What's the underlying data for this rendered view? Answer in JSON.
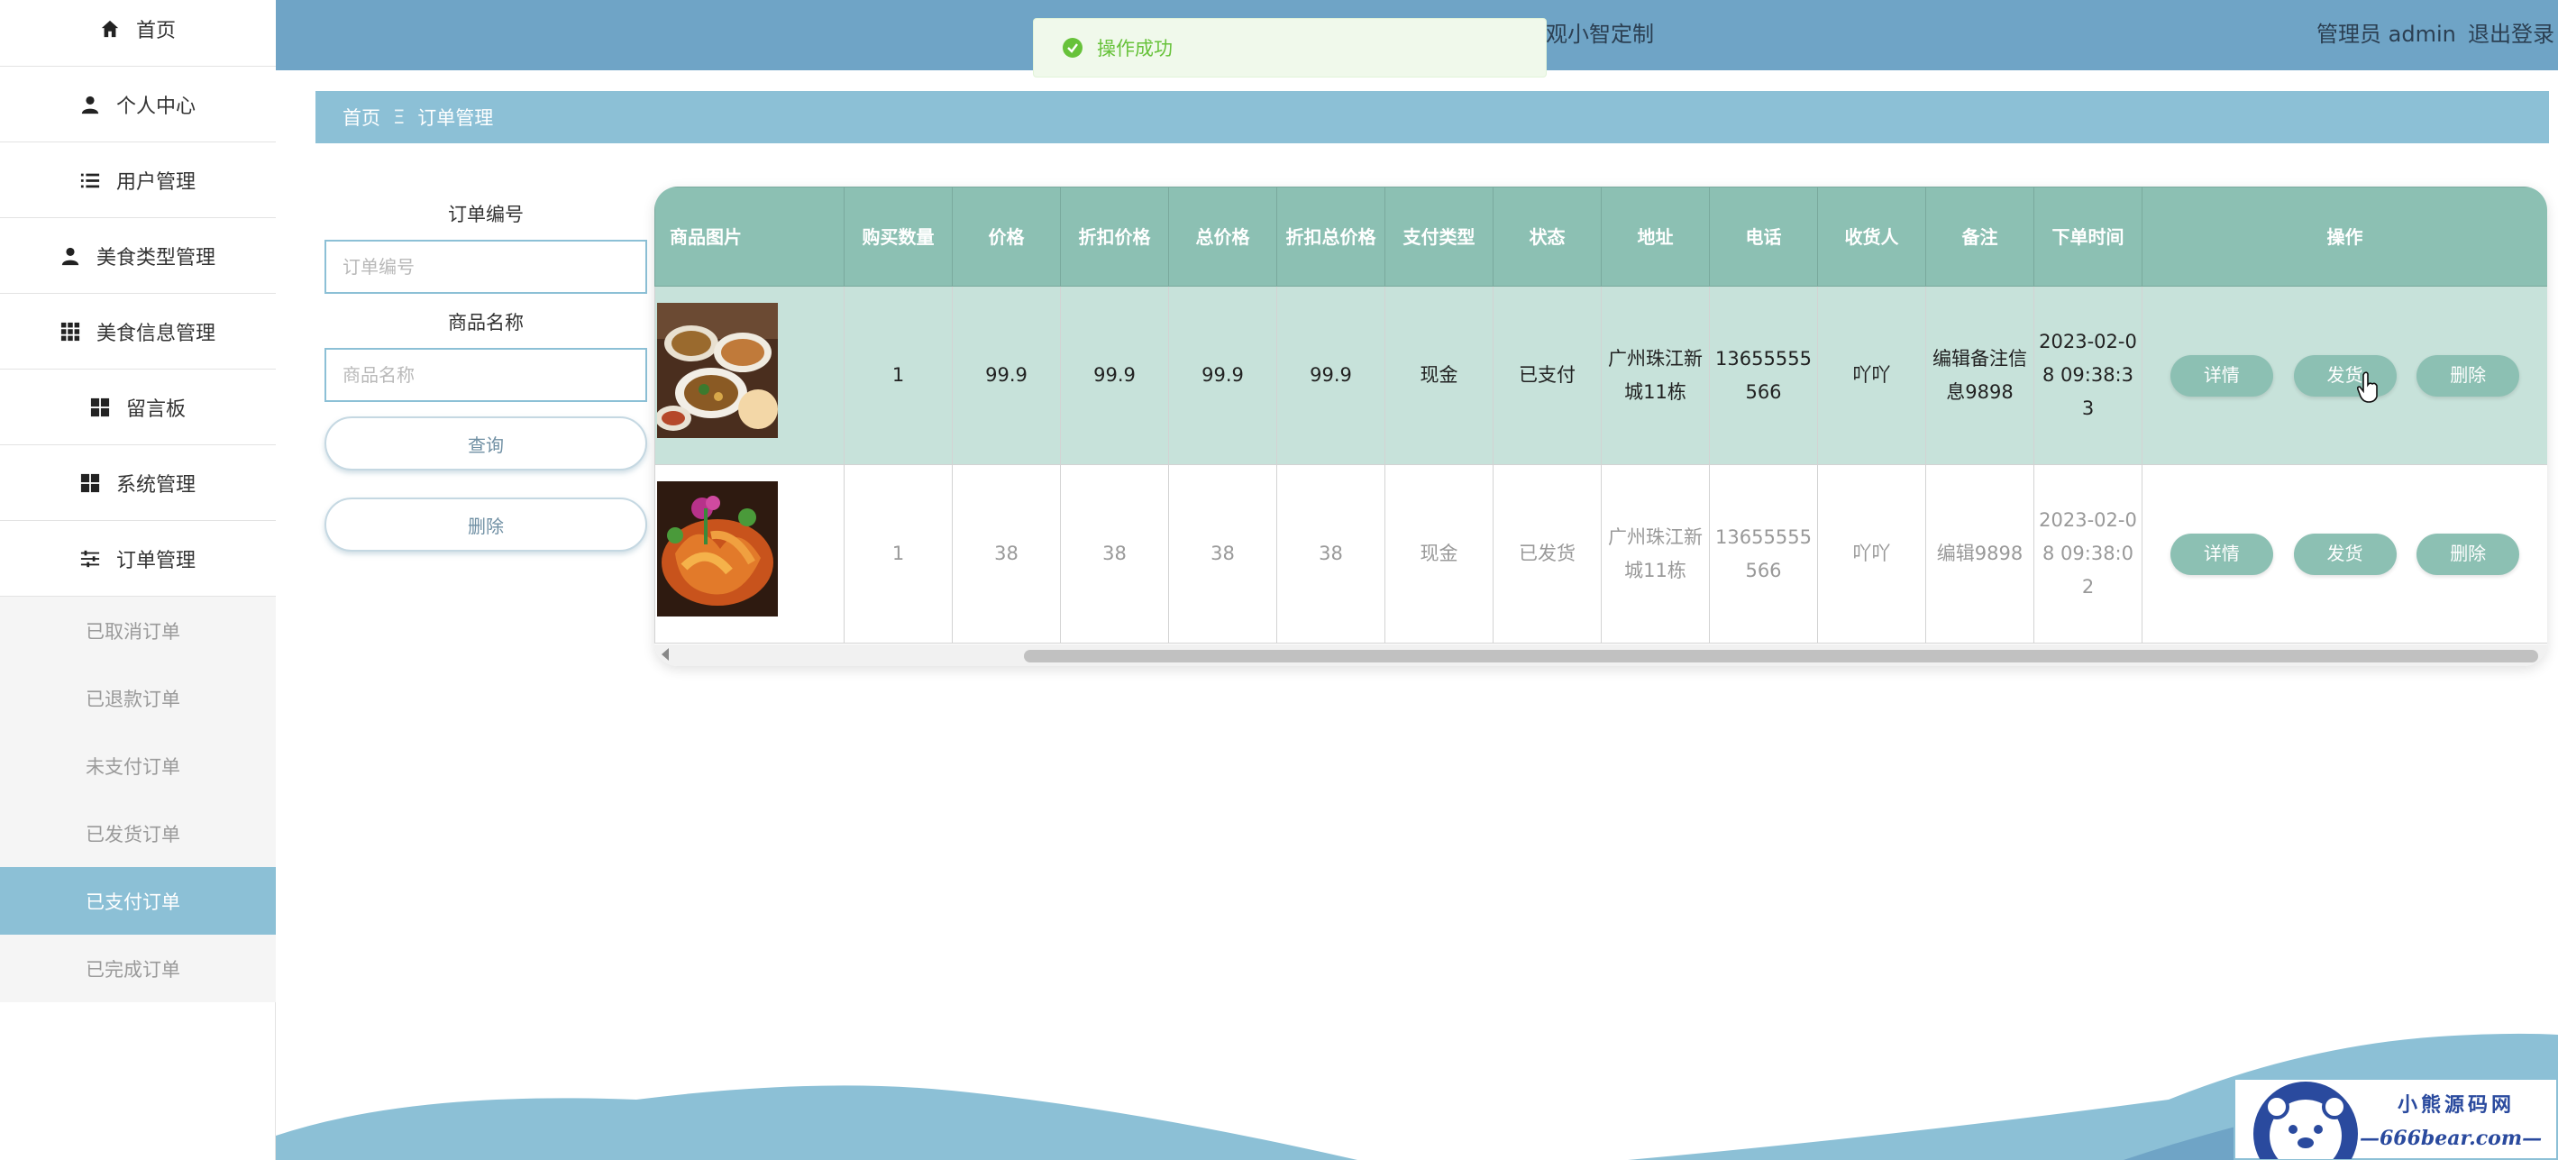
{
  "sidebar": {
    "menu": [
      {
        "label": "首页",
        "icon": "home-icon"
      },
      {
        "label": "个人中心",
        "icon": "user-icon"
      },
      {
        "label": "用户管理",
        "icon": "list-icon"
      },
      {
        "label": "美食类型管理",
        "icon": "user-icon"
      },
      {
        "label": "美食信息管理",
        "icon": "grid-icon"
      },
      {
        "label": "留言板",
        "icon": "grid-icon"
      },
      {
        "label": "系统管理",
        "icon": "grid-icon"
      },
      {
        "label": "订单管理",
        "icon": "sliders-icon"
      }
    ],
    "submenu": [
      {
        "label": "已取消订单"
      },
      {
        "label": "已退款订单"
      },
      {
        "label": "未支付订单"
      },
      {
        "label": "已发货订单"
      },
      {
        "label": "已支付订单",
        "active": true
      },
      {
        "label": "已完成订单"
      }
    ]
  },
  "header": {
    "title": "观小智定制",
    "admin": "管理员 admin",
    "logout": "退出登录"
  },
  "toast": {
    "message": "操作成功",
    "icon": "check-circle-icon",
    "color": "#67c23a"
  },
  "breadcrumb": {
    "home": "首页",
    "separator": "Ξ",
    "current": "订单管理"
  },
  "search": {
    "order_no_label": "订单编号",
    "order_no_placeholder": "订单编号",
    "order_no_value": "",
    "product_label": "商品名称",
    "product_placeholder": "商品名称",
    "product_value": "",
    "query_label": "查询",
    "delete_label": "删除"
  },
  "table": {
    "headers": [
      "商品图片",
      "购买数量",
      "价格",
      "折扣价格",
      "总价格",
      "折扣总价格",
      "支付类型",
      "状态",
      "地址",
      "电话",
      "收货人",
      "备注",
      "下单时间",
      "操作"
    ],
    "rows": [
      {
        "image": "food-plates-image",
        "qty": "1",
        "price": "99.9",
        "discount_price": "99.9",
        "total": "99.9",
        "discount_total": "99.9",
        "pay_type": "现金",
        "status": "已支付",
        "address": "广州珠江新城11栋",
        "phone": "13655555566",
        "receiver": "吖吖",
        "note": "编辑备注信息9898",
        "time": "2023-02-08 09:38:33",
        "actions": {
          "detail": "详情",
          "ship": "发货",
          "delete": "删除"
        }
      },
      {
        "image": "fried-shrimp-image",
        "qty": "1",
        "price": "38",
        "discount_price": "38",
        "total": "38",
        "discount_total": "38",
        "pay_type": "现金",
        "status": "已发货",
        "address": "广州珠江新城11栋",
        "phone": "13655555566",
        "receiver": "吖吖",
        "note": "编辑9898",
        "time": "2023-02-08 09:38:02",
        "actions": {
          "detail": "详情",
          "ship": "发货",
          "delete": "删除"
        }
      }
    ]
  },
  "watermark": {
    "line1": "小熊源码网",
    "line2": "—666bear.com—"
  },
  "colors": {
    "header": "#6fa4c6",
    "accent": "#8cc0d6",
    "table_header": "#8cc0b3",
    "row_highlight": "#c7e2da",
    "success": "#67c23a"
  }
}
